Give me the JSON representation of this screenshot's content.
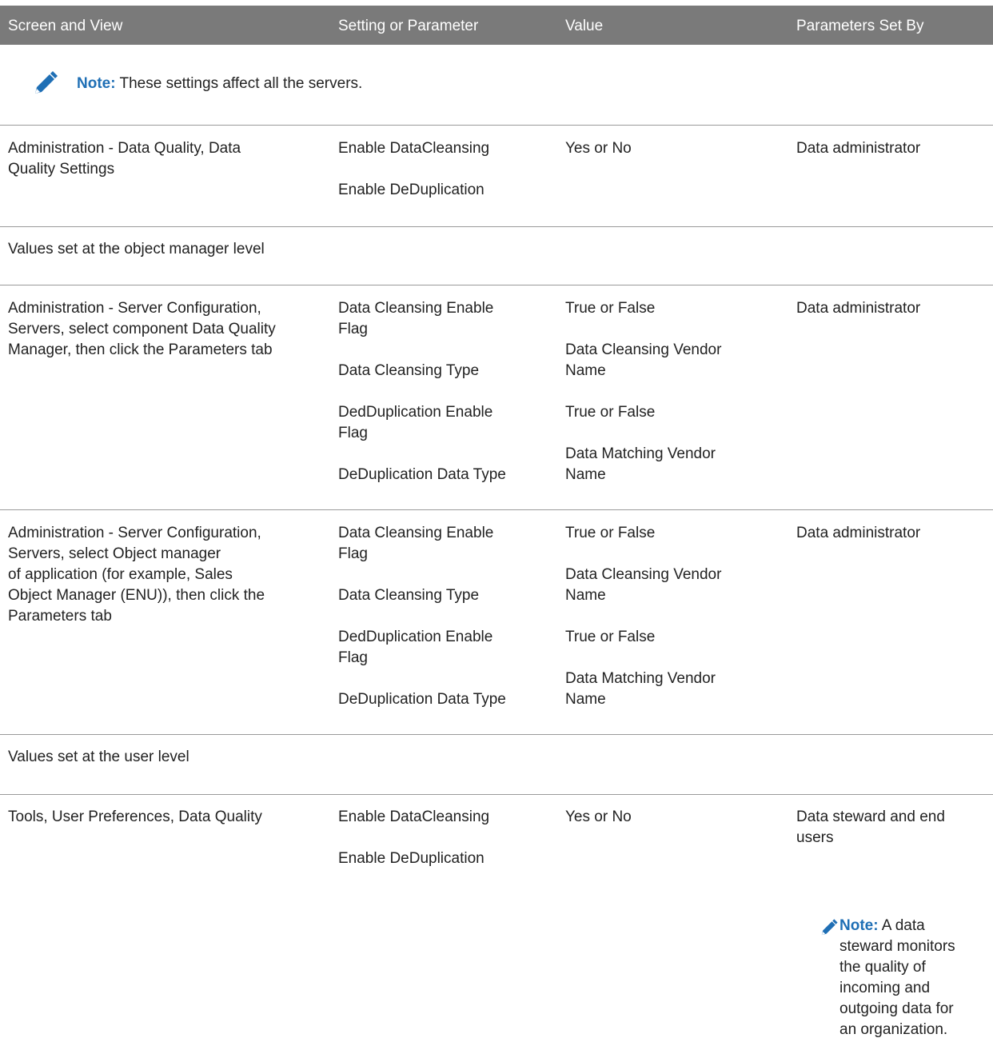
{
  "header": {
    "col1": "Screen and View",
    "col2": "Setting or Parameter",
    "col3": "Value",
    "col4": "Parameters Set By"
  },
  "note_top": {
    "icon": "pencil-icon",
    "label": "Note:",
    "text": "These settings affect all the servers."
  },
  "row1": {
    "screen": [
      "Administration - Data Quality, Data",
      "Quality Settings"
    ],
    "settings": [
      "Enable DataCleansing",
      "Enable DeDuplication"
    ],
    "value": "Yes or No",
    "set_by": "Data administrator"
  },
  "section_om": "Values set at the object manager level",
  "row2": {
    "screen": [
      "Administration - Server Configuration,",
      "Servers, select component Data Quality",
      "Manager, then click the Parameters tab"
    ],
    "settings": [
      [
        "Data Cleansing Enable",
        "Flag"
      ],
      [
        "Data Cleansing Type"
      ],
      [
        "DedDuplication Enable",
        "Flag"
      ],
      [
        "DeDuplication Data Type"
      ]
    ],
    "values": [
      [
        "True or False"
      ],
      [
        "Data Cleansing Vendor",
        "Name"
      ],
      [
        "True or False"
      ],
      [
        "Data Matching Vendor",
        "Name"
      ]
    ],
    "set_by": "Data administrator"
  },
  "row3": {
    "screen": [
      "Administration - Server Configuration,",
      "Servers, select Object manager",
      "of application (for example, Sales",
      "Object Manager (ENU)), then click the",
      "Parameters tab"
    ],
    "settings": [
      [
        "Data Cleansing Enable",
        "Flag"
      ],
      [
        "Data Cleansing Type"
      ],
      [
        "DedDuplication Enable",
        "Flag"
      ],
      [
        "DeDuplication Data Type"
      ]
    ],
    "values": [
      [
        "True or False"
      ],
      [
        "Data Cleansing Vendor",
        "Name"
      ],
      [
        "True or False"
      ],
      [
        "Data Matching Vendor",
        "Name"
      ]
    ],
    "set_by": "Data administrator"
  },
  "section_user": "Values set at the user level",
  "row4": {
    "screen": "Tools, User Preferences, Data Quality",
    "settings": [
      "Enable DataCleansing",
      "Enable DeDuplication"
    ],
    "value": "Yes or No",
    "set_by": [
      "Data steward and end",
      "users"
    ]
  },
  "note_bottom": {
    "icon": "pencil-icon",
    "label": "Note:",
    "text_first": "A data",
    "lines": [
      "steward monitors",
      "the quality of",
      "incoming and",
      "outgoing data for",
      "an organization."
    ]
  },
  "colors": {
    "header_bg": "#7a7a7a",
    "note_accent": "#1f6fb5",
    "rule": "#9a9a9a"
  }
}
